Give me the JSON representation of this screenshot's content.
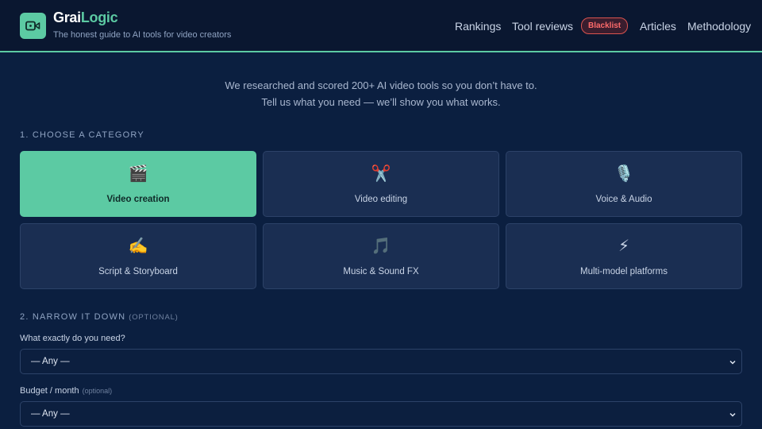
{
  "brand": {
    "name_part1": "Grai",
    "name_part2": "Logic",
    "tagline": "The honest guide to AI tools for video creators",
    "logo_icon": "video-camera-icon"
  },
  "nav": {
    "items": [
      "Rankings",
      "Tool reviews",
      "Blacklist",
      "Articles",
      "Methodology"
    ]
  },
  "intro": {
    "line1": "We researched and scored 200+ AI video tools so you don’t have to.",
    "line2": "Tell us what you need — we’ll show you what works."
  },
  "step1": {
    "title": "1. CHOOSE A CATEGORY",
    "categories": [
      {
        "label": "Video creation",
        "icon": "🎬",
        "selected": true
      },
      {
        "label": "Video editing",
        "icon": "✂️",
        "selected": false
      },
      {
        "label": "Voice & Audio",
        "icon": "🎙️",
        "selected": false
      },
      {
        "label": "Script & Storyboard",
        "icon": "✍️",
        "selected": false
      },
      {
        "label": "Music & Sound FX",
        "icon": "🎵",
        "selected": false
      },
      {
        "label": "Multi-model platforms",
        "icon": "⚡",
        "selected": false
      }
    ]
  },
  "step2": {
    "title": "2. NARROW IT DOWN",
    "optional": "(OPTIONAL)",
    "need_label": "What exactly do you need?",
    "need_value": "— Any —",
    "budget_label": "Budget / month",
    "budget_optional": "(optional)",
    "budget_value": "— Any —"
  },
  "colors": {
    "background": "#0b1f40",
    "header": "#0a1730",
    "accent": "#5ccaa3",
    "card": "#1a2e52",
    "badge": "#ff6b6b"
  }
}
